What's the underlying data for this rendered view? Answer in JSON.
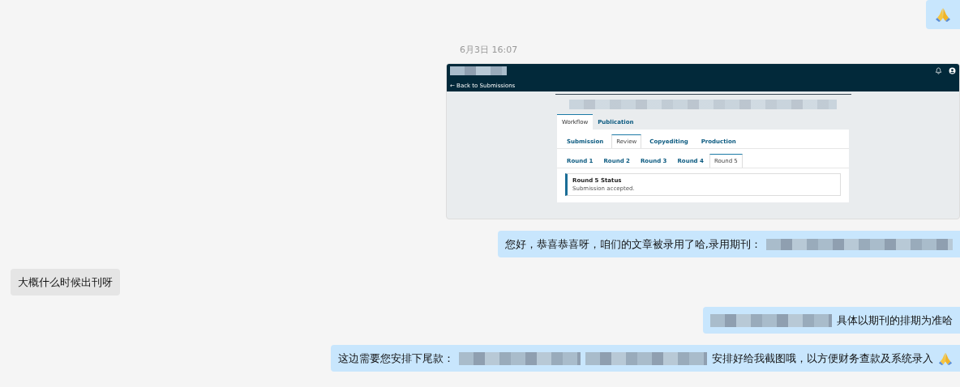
{
  "messages": [
    {
      "kind": "emoji",
      "outgoing": true
    },
    {
      "kind": "time",
      "text": "6月3日 16:07"
    },
    {
      "kind": "screenshot",
      "outgoing": true,
      "screenshot": {
        "back_link": "← Back to Submissions",
        "tabs": [
          {
            "label": "Workflow",
            "selected": true
          },
          {
            "label": "Publication",
            "selected": false
          }
        ],
        "stage_tabs": [
          {
            "label": "Submission",
            "selected": false
          },
          {
            "label": "Review",
            "selected": true
          },
          {
            "label": "Copyediting",
            "selected": false
          },
          {
            "label": "Production",
            "selected": false
          }
        ],
        "round_tabs": [
          {
            "label": "Round 1",
            "selected": false
          },
          {
            "label": "Round 2",
            "selected": false
          },
          {
            "label": "Round 3",
            "selected": false
          },
          {
            "label": "Round 4",
            "selected": false
          },
          {
            "label": "Round 5",
            "selected": true
          }
        ],
        "status": {
          "title": "Round 5 Status",
          "text": "Submission accepted."
        }
      }
    },
    {
      "kind": "text",
      "outgoing": true,
      "parts": [
        {
          "kind": "text",
          "text": "您好，恭喜恭喜呀，咱们的文章被录用了哈,录用期刊："
        },
        {
          "kind": "redacted"
        }
      ]
    },
    {
      "kind": "text",
      "outgoing": false,
      "parts": [
        {
          "kind": "text",
          "text": "大概什么时候出刊呀"
        }
      ]
    },
    {
      "kind": "text",
      "outgoing": true,
      "parts": [
        {
          "kind": "redacted"
        },
        {
          "kind": "text",
          "text": "具体以期刊的排期为准哈"
        }
      ]
    },
    {
      "kind": "text",
      "outgoing": true,
      "parts": [
        {
          "kind": "text",
          "text": "这边需要您安排下尾款："
        },
        {
          "kind": "redacted"
        },
        {
          "kind": "redacted"
        },
        {
          "kind": "text",
          "text": "安排好给我截图哦，以方便财务查款及系统录入"
        },
        {
          "kind": "emoji"
        }
      ]
    }
  ]
}
